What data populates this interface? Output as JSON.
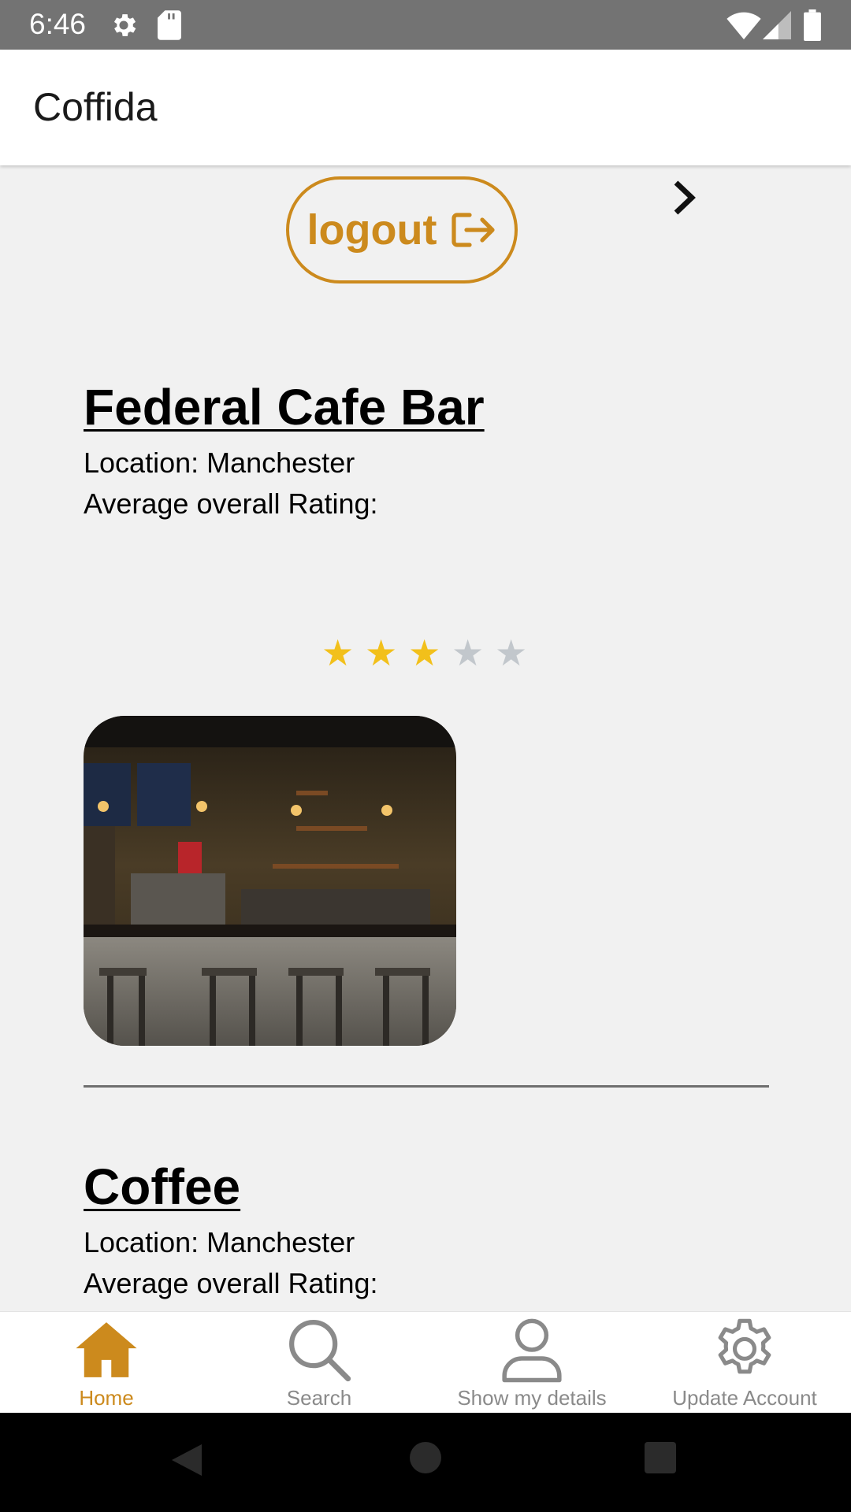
{
  "status_bar": {
    "time": "6:46"
  },
  "app_bar": {
    "title": "Coffida"
  },
  "actions": {
    "logout_label": "logout"
  },
  "shops": [
    {
      "name": "Federal Cafe Bar",
      "location": "Location: Manchester",
      "rating_label": "Average overall Rating:",
      "rating_stars": 3,
      "rating_max": 5
    },
    {
      "name": "Coffee",
      "location": "Location: Manchester",
      "rating_label": "Average overall Rating:"
    }
  ],
  "bottom_nav": {
    "items": [
      {
        "label": "Home",
        "icon": "home-icon",
        "active": true
      },
      {
        "label": "Search",
        "icon": "search-icon",
        "active": false
      },
      {
        "label": "Show my details",
        "icon": "person-icon",
        "active": false
      },
      {
        "label": "Update Account",
        "icon": "gear-icon",
        "active": false
      }
    ]
  },
  "colors": {
    "accent": "#cc8a1d",
    "star_filled": "#f2c01b",
    "star_empty": "#c2c7cc",
    "status_bar": "#737373"
  }
}
